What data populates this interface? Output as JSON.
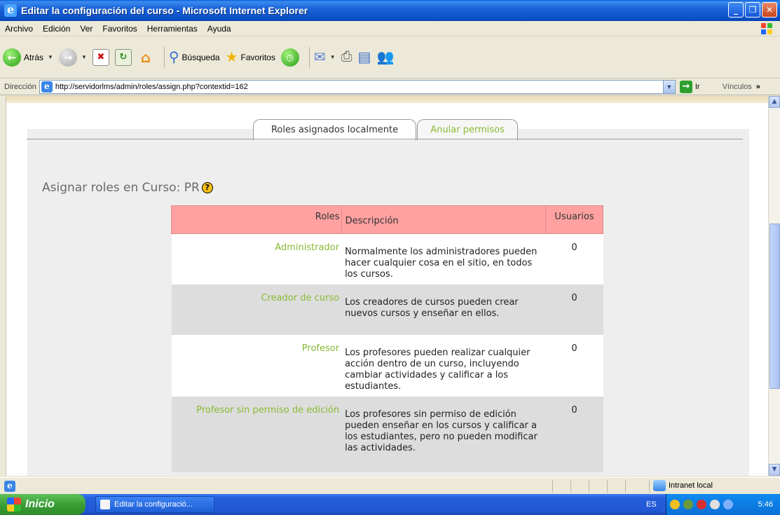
{
  "window": {
    "title": "Editar la configuración del curso - Microsoft Internet Explorer",
    "minimize": "_",
    "maximize": "❐",
    "close": "✕"
  },
  "menu": [
    "Archivo",
    "Edición",
    "Ver",
    "Favoritos",
    "Herramientas",
    "Ayuda"
  ],
  "toolbar": {
    "back_label": "Atrás",
    "search_label": "Búsqueda",
    "favorites_label": "Favoritos"
  },
  "address": {
    "label": "Dirección",
    "url": "http://servidorlms/admin/roles/assign.php?contextid=162",
    "go_label": "Ir",
    "links_label": "Vínculos"
  },
  "tabs": {
    "active": "Roles asignados localmente",
    "inactive": "Anular permisos"
  },
  "heading": "Asignar roles en Curso: PR",
  "help_glyph": "?",
  "table": {
    "headers": [
      "Roles",
      "Descripción",
      "Usuarios"
    ],
    "rows": [
      {
        "role": "Administrador",
        "description": "Normalmente los administradores pueden hacer cualquier cosa en el sitio, en todos los cursos.",
        "users": "0"
      },
      {
        "role": "Creador de curso",
        "description": "Los creadores de cursos pueden crear nuevos cursos y enseñar en ellos.",
        "users": "0"
      },
      {
        "role": "Profesor",
        "description": "Los profesores pueden realizar cualquier acción dentro de un curso, incluyendo cambiar actividades y calificar a los estudiantes.",
        "users": "0"
      },
      {
        "role": "Profesor sin permiso de edición",
        "description": "Los profesores sin permiso de edición pueden enseñar en los cursos y calificar a los estudiantes, pero no pueden modificar las actividades.",
        "users": "0"
      }
    ]
  },
  "status": {
    "zone": "Intranet local"
  },
  "taskbar": {
    "start": "Inicio",
    "task": "Editar la configuració...",
    "lang": "ES",
    "clock": "5:46"
  },
  "colors": {
    "link_green": "#88bb33",
    "header_pink": "#ffa1a1",
    "row_gray": "#dddddd"
  }
}
